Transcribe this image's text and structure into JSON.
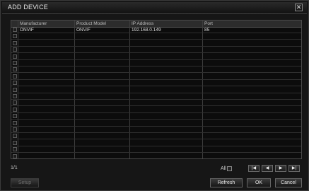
{
  "window": {
    "title": "ADD DEVICE",
    "close_icon": "close-icon",
    "close_glyph": "✕"
  },
  "table": {
    "headers": [
      "Manufacturer",
      "Product Model",
      "IP Address",
      "Port"
    ],
    "rows": [
      [
        "ONVIF",
        "ONVIF",
        "192.168.0.149",
        "85"
      ]
    ],
    "total_rows_visible": 20
  },
  "pagination": {
    "page": "1/1"
  },
  "select_all": {
    "label": "All"
  },
  "nav": {
    "first": "|◀",
    "prev": "◀",
    "next": "▶",
    "last": "▶|"
  },
  "buttons": {
    "setup": "Setup",
    "refresh": "Refresh",
    "ok": "OK",
    "cancel": "Cancel"
  }
}
